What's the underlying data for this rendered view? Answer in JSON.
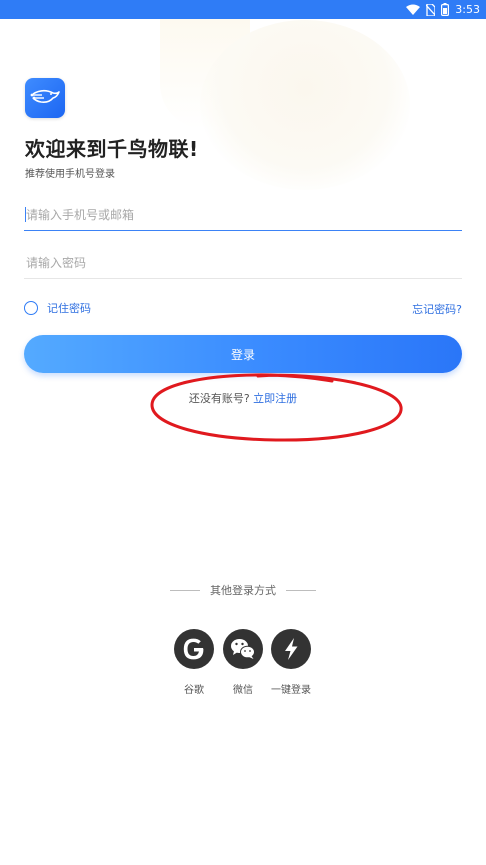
{
  "status_bar": {
    "time": "3:53"
  },
  "app": {
    "welcome_title": "欢迎来到千鸟物联!",
    "subtitle": "推荐使用手机号登录"
  },
  "form": {
    "phone_placeholder": "请输入手机号或邮箱",
    "password_placeholder": "请输入密码",
    "remember_label": "记住密码",
    "forgot_label": "忘记密码?",
    "login_label": "登录"
  },
  "register": {
    "question": "还没有账号?",
    "link": "立即注册"
  },
  "other_login": {
    "title": "其他登录方式",
    "methods": [
      {
        "label": "谷歌",
        "icon": "google-icon"
      },
      {
        "label": "微信",
        "icon": "wechat-icon"
      },
      {
        "label": "一键登录",
        "icon": "lightning-icon"
      }
    ]
  },
  "colors": {
    "status_bar": "#2f7cf6",
    "accent": "#2f6fe0",
    "button_start": "#54aaff",
    "button_end": "#2a76f8",
    "annotation": "#e0191e"
  }
}
